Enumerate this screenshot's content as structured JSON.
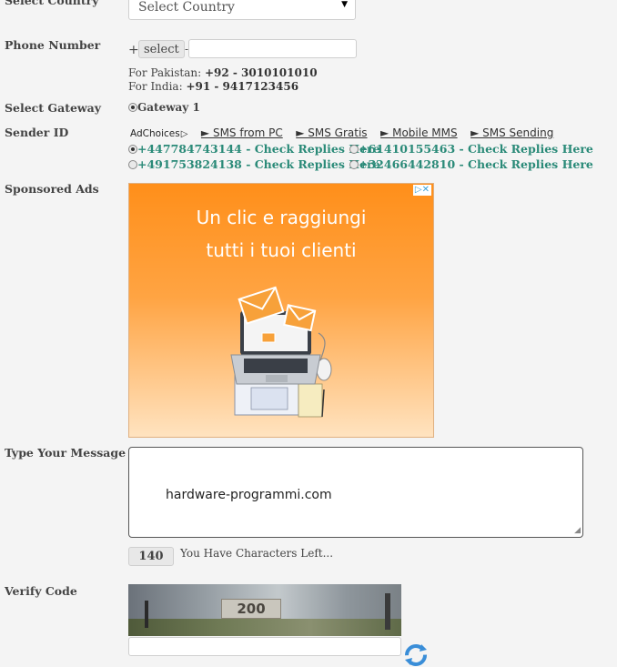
{
  "country": {
    "label": "Select Country",
    "value": "Select Country"
  },
  "phone": {
    "label": "Phone Number",
    "plus": "+",
    "code_button": "select",
    "separator": "-",
    "hint_pk_prefix": "For Pakistan: ",
    "hint_pk_value": "+92 - 3010101010",
    "hint_in_prefix": "For India: ",
    "hint_in_value": "+91 - 9417123456"
  },
  "gateway": {
    "label": "Select Gateway",
    "option": "Gateway 1"
  },
  "sender": {
    "label": "Sender ID",
    "ad_links": {
      "adchoices": "AdChoices",
      "links": [
        "► SMS from PC",
        "► SMS Gratis",
        "► Mobile MMS",
        "► SMS Sending"
      ]
    },
    "options": [
      "+447784743144 - Check Replies Here",
      "+61410155463 - Check Replies Here",
      "+491753824138 - Check Replies Here",
      "+32466442810 - Check Replies Here"
    ]
  },
  "sponsored": {
    "label": "Sponsored Ads",
    "ad_line1": "Un clic e raggiungi",
    "ad_line2": "tutti i tuoi clienti",
    "close": "▷✕"
  },
  "message": {
    "label": "Type Your Message",
    "value": "hardware-programmi.com",
    "chars_left": "140",
    "chars_label": "You Have Characters Left..."
  },
  "verify": {
    "label": "Verify Code",
    "captcha_text": "200"
  },
  "colors": {
    "link_green": "#2a8a78",
    "ad_orange": "#ff8f1a"
  }
}
